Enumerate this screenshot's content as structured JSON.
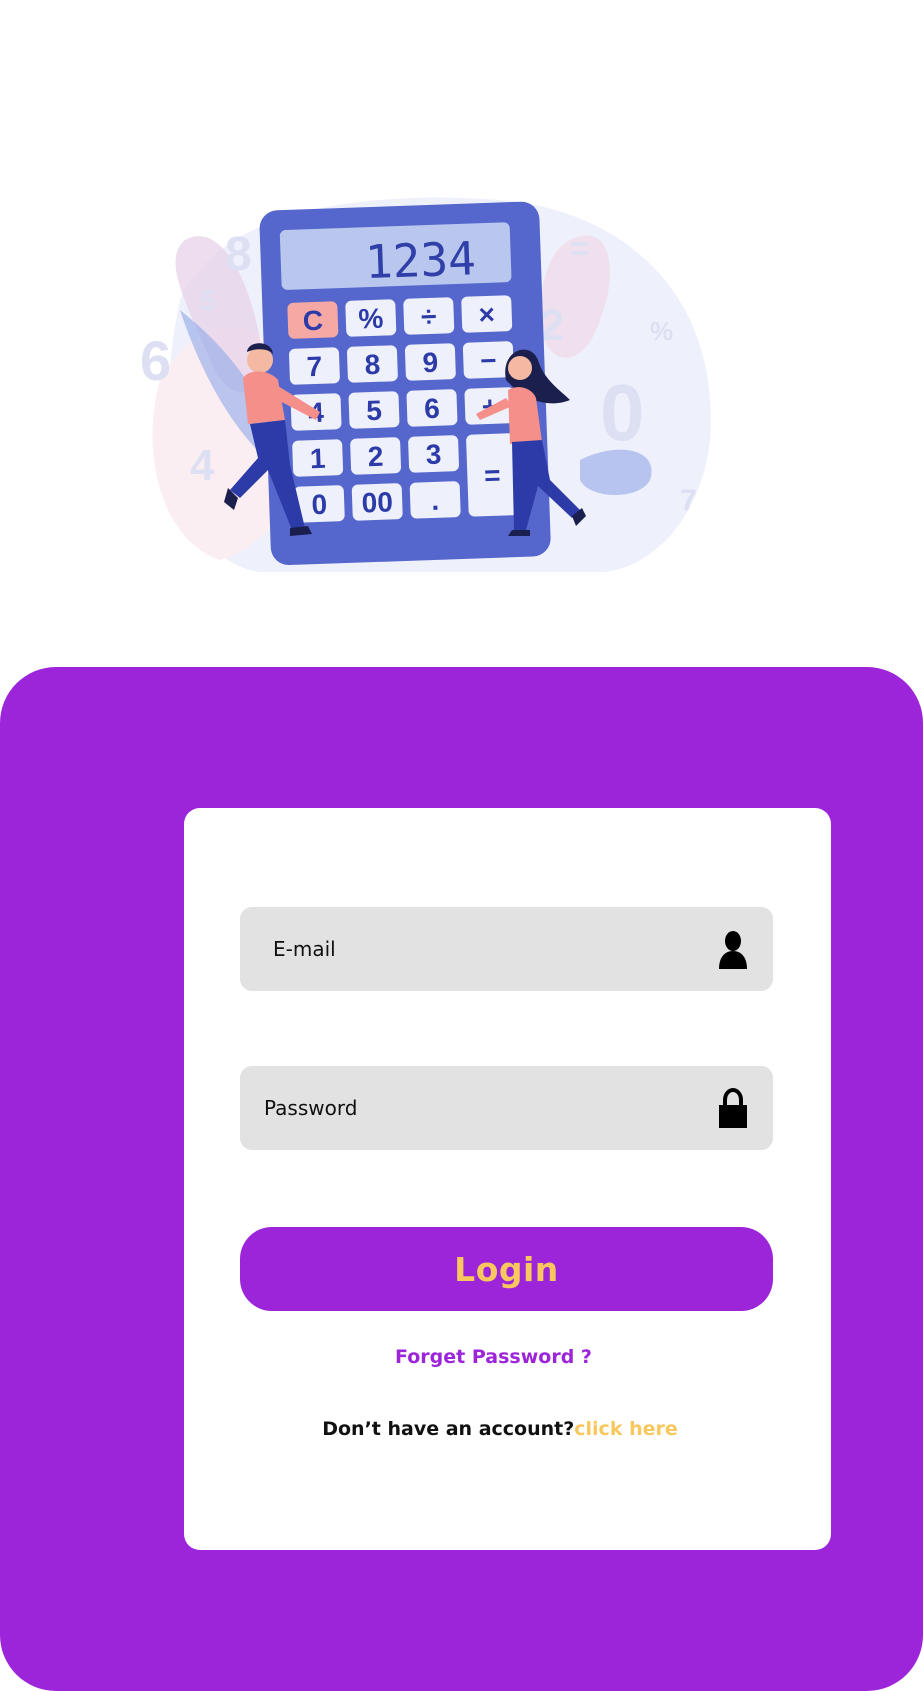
{
  "hero": {
    "display_value": "1234",
    "keys": [
      [
        "C",
        "%",
        "÷",
        "×"
      ],
      [
        "7",
        "8",
        "9",
        "−"
      ],
      [
        "4",
        "5",
        "6",
        "+"
      ],
      [
        "1",
        "2",
        "3",
        "="
      ],
      [
        "0",
        "00",
        ".",
        ""
      ]
    ]
  },
  "form": {
    "email_placeholder": "E-mail",
    "password_placeholder": "Password",
    "login_label": "Login",
    "forgot_label": "Forget Password ?",
    "signup_prompt": "Don’t have an account?",
    "signup_link": "click here"
  },
  "colors": {
    "brand_purple": "#9d25d9",
    "accent_yellow": "#f8c75d",
    "field_gray": "#e2e2e2"
  },
  "icons": {
    "email": "user-icon",
    "password": "lock-icon"
  }
}
